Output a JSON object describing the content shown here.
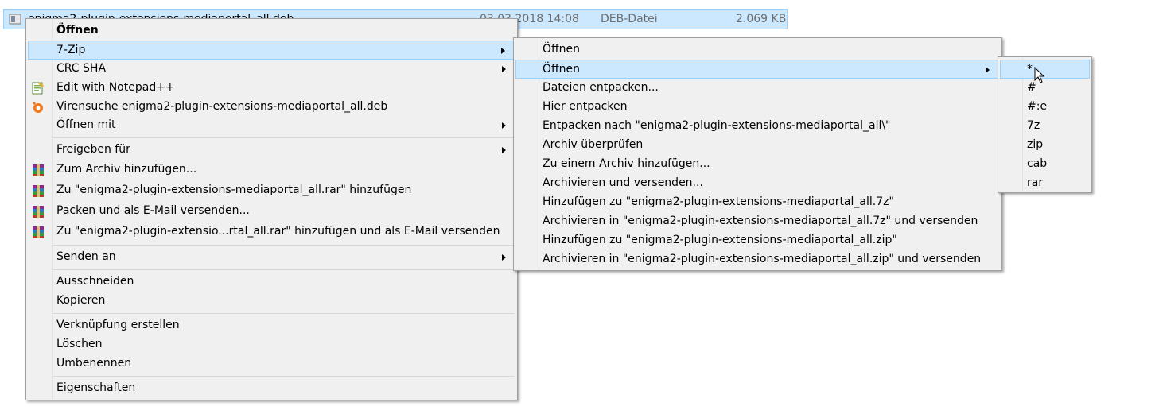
{
  "file": {
    "name": "enigma2-plugin-extensions-mediaportal_all.deb",
    "date": "03.03.2018 14:08",
    "type": "DEB-Datei",
    "size": "2.069 KB"
  },
  "main_menu": {
    "open": "Öffnen",
    "seven_zip": "7-Zip",
    "crc_sha": "CRC SHA",
    "edit_notepad": "Edit with Notepad++",
    "virus_scan": "Virensuche enigma2-plugin-extensions-mediaportal_all.deb",
    "open_with": "Öffnen mit",
    "share_with": "Freigeben für",
    "add_archive": "Zum Archiv hinzufügen...",
    "add_rar": "Zu \"enigma2-plugin-extensions-mediaportal_all.rar\" hinzufügen",
    "pack_email": "Packen und als E-Mail versenden...",
    "add_rar_email": "Zu \"enigma2-plugin-extensio...rtal_all.rar\" hinzufügen und als E-Mail versenden",
    "send_to": "Senden an",
    "cut": "Ausschneiden",
    "copy": "Kopieren",
    "create_shortcut": "Verknüpfung erstellen",
    "delete": "Löschen",
    "rename": "Umbenennen",
    "properties": "Eigenschaften"
  },
  "zip_menu": {
    "open": "Öffnen",
    "open_sub": "Öffnen",
    "extract_files": "Dateien entpacken...",
    "extract_here": "Hier entpacken",
    "extract_to": "Entpacken nach \"enigma2-plugin-extensions-mediaportal_all\\\"",
    "test_archive": "Archiv überprüfen",
    "add_to_archive": "Zu einem Archiv hinzufügen...",
    "archive_send": "Archivieren und versenden...",
    "add_7z": "Hinzufügen zu \"enigma2-plugin-extensions-mediaportal_all.7z\"",
    "archive_7z_send": "Archivieren in \"enigma2-plugin-extensions-mediaportal_all.7z\" und versenden",
    "add_zip": "Hinzufügen zu \"enigma2-plugin-extensions-mediaportal_all.zip\"",
    "archive_zip_send": "Archivieren in \"enigma2-plugin-extensions-mediaportal_all.zip\" und versenden"
  },
  "open_menu": {
    "items": [
      "*",
      "#",
      "#:e",
      "7z",
      "zip",
      "cab",
      "rar"
    ]
  },
  "colors": {
    "menu_bg": "#f0f0f0",
    "highlight": "#cce8ff",
    "highlight_border": "#99d1ff"
  }
}
